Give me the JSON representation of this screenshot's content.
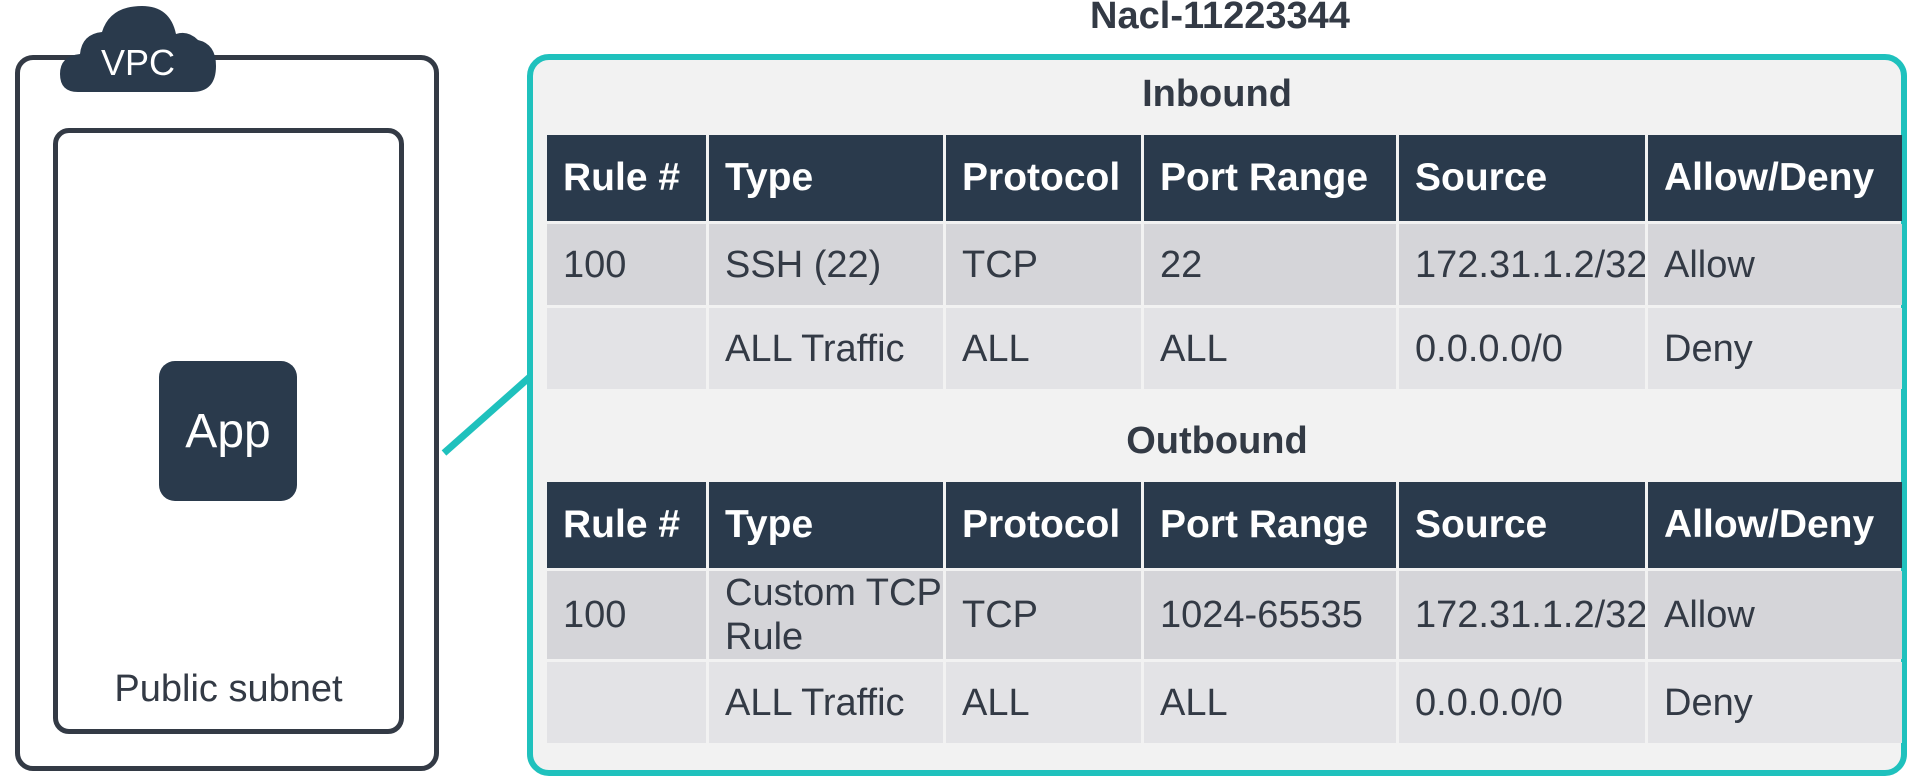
{
  "vpc": {
    "label": "VPC",
    "subnet_label": "Public subnet",
    "app_label": "App"
  },
  "nacl": {
    "title": "Nacl-11223344",
    "columns": [
      "Rule #",
      "Type",
      "Protocol",
      "Port Range",
      "Source",
      "Allow/Deny"
    ],
    "inbound": {
      "title": "Inbound",
      "rows": [
        {
          "rule": "100",
          "type": "SSH (22)",
          "protocol": "TCP",
          "port_range": "22",
          "source": "172.31.1.2/32",
          "action": "Allow"
        },
        {
          "rule": "",
          "type": "ALL Traffic",
          "protocol": "ALL",
          "port_range": "ALL",
          "source": "0.0.0.0/0",
          "action": "Deny"
        }
      ]
    },
    "outbound": {
      "title": "Outbound",
      "rows": [
        {
          "rule": "100",
          "type": "Custom TCP Rule",
          "protocol": "TCP",
          "port_range": "1024-65535",
          "source": "172.31.1.2/32",
          "action": "Allow"
        },
        {
          "rule": "",
          "type": "ALL Traffic",
          "protocol": "ALL",
          "port_range": "ALL",
          "source": "0.0.0.0/0",
          "action": "Deny"
        }
      ]
    }
  },
  "colors": {
    "dark": "#2a3a4c",
    "teal": "#1fc1bd",
    "allow": "#1aab65",
    "deny": "#e5344f"
  }
}
